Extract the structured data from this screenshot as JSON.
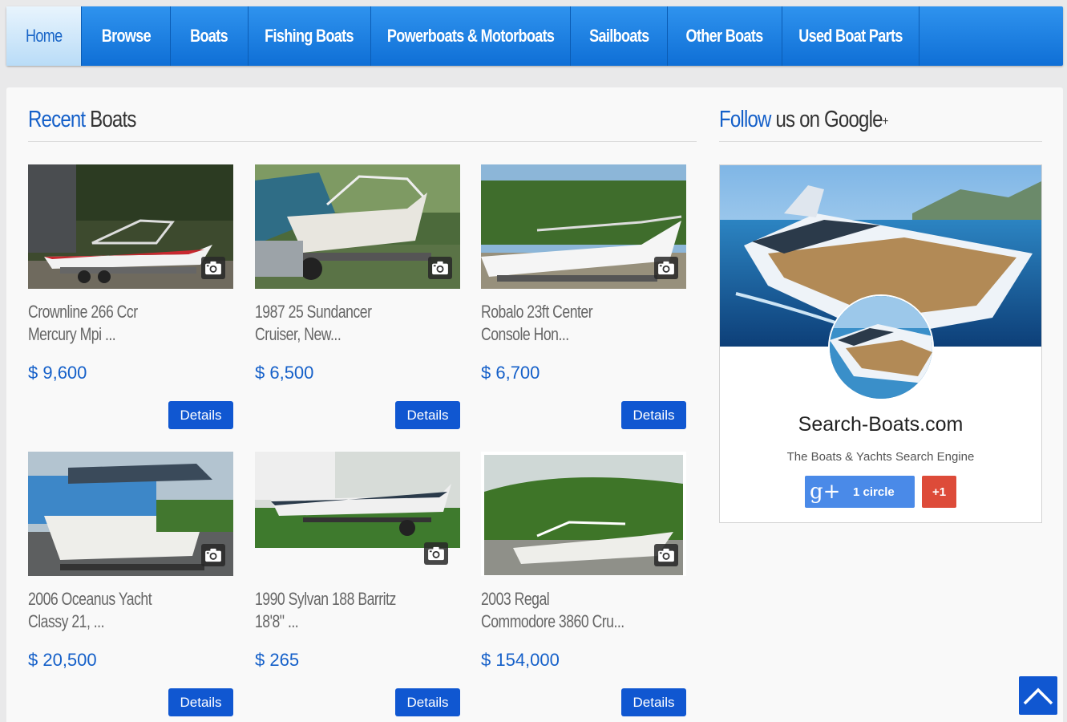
{
  "nav": {
    "items": [
      "Home",
      "Browse",
      "Boats",
      "Fishing Boats",
      "Powerboats & Motorboats",
      "Sailboats",
      "Other Boats",
      "Used Boat Parts"
    ]
  },
  "recent": {
    "title_accent": "Recent",
    "title_rest": "Boats"
  },
  "follow": {
    "title_accent": "Follow",
    "title_rest": "us on Google",
    "title_plus": "+"
  },
  "listings": [
    {
      "line1": "Crownline 266 Ccr",
      "line2": "Mercury Mpi ...",
      "price": "$ 9,600",
      "button": "Details"
    },
    {
      "line1": "1987 25 Sundancer",
      "line2": "Cruiser, New...",
      "price": "$ 6,500",
      "button": "Details"
    },
    {
      "line1": "Robalo 23ft Center",
      "line2": "Console Hon...",
      "price": "$ 6,700",
      "button": "Details"
    },
    {
      "line1": "2006 Oceanus Yacht",
      "line2": "Classy 21, ...",
      "price": "$ 20,500",
      "button": "Details"
    },
    {
      "line1": "1990 Sylvan 188 Barritz",
      "line2": "18'8\" ...",
      "price": "$ 265",
      "button": "Details"
    },
    {
      "line1": "2003 Regal",
      "line2": "Commodore 3860 Cru...",
      "price": "$ 154,000",
      "button": "Details"
    }
  ],
  "google": {
    "name": "Search-Boats.com",
    "tagline": "The Boats & Yachts Search Engine",
    "follow_icon": "g+",
    "follow_label": "1 circle",
    "plus_one": "+1"
  },
  "icons": {
    "camera": "camera-icon",
    "scroll_top": "chevron-up-icon"
  },
  "colors": {
    "nav_blue": "#1a7ce0",
    "accent": "#1560c9",
    "button": "#1057d1",
    "gplus_red": "#dd4b39",
    "gfollow_blue": "#4a8ae8"
  }
}
